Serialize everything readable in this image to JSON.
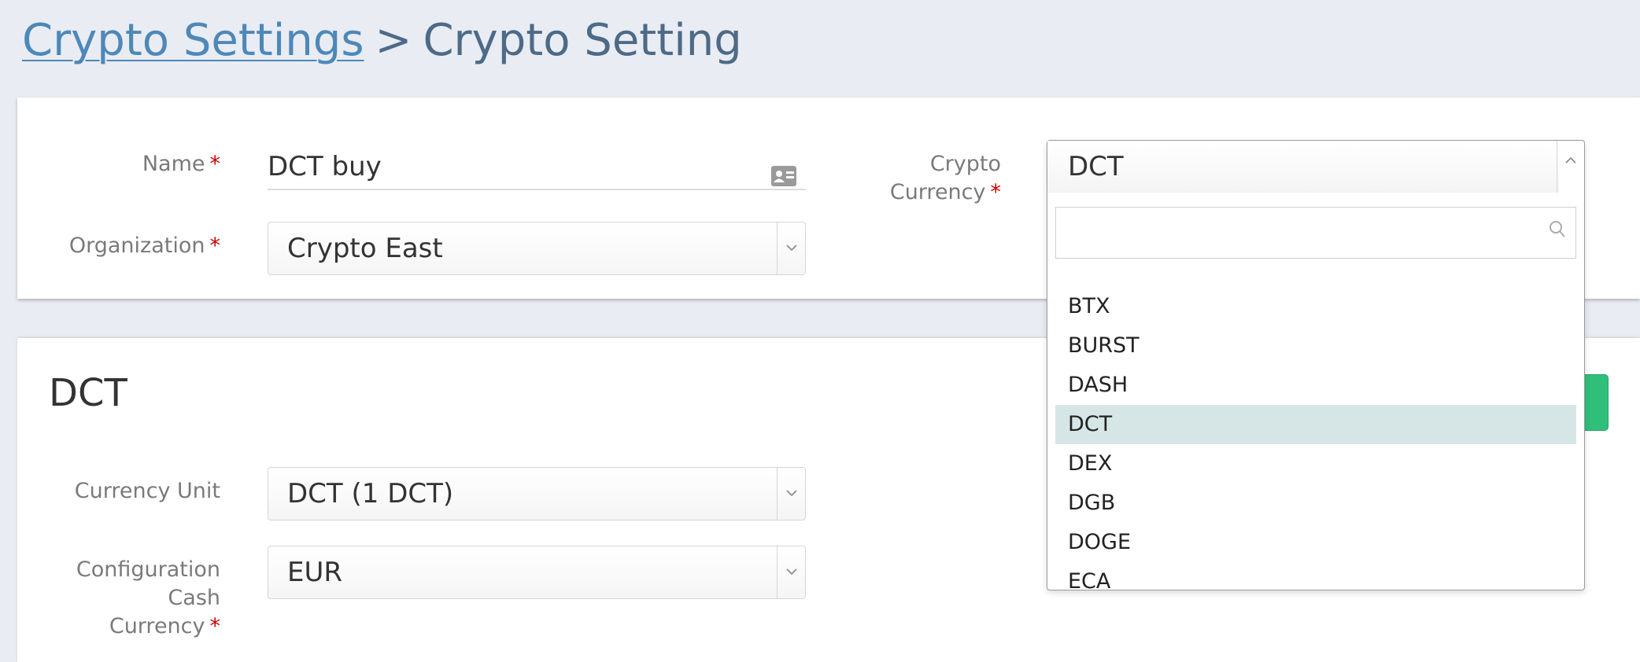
{
  "breadcrumb": {
    "parent": "Crypto Settings",
    "separator": ">",
    "current": "Crypto Setting"
  },
  "form": {
    "name_label": "Name",
    "name_value": "DCT buy",
    "organization_label": "Organization",
    "organization_value": "Crypto East",
    "crypto_currency_label_line1": "Crypto",
    "crypto_currency_label_line2": "Currency",
    "required_mark": "*"
  },
  "section": {
    "title": "DCT",
    "currency_unit_label": "Currency Unit",
    "currency_unit_value": "DCT (1 DCT)",
    "config_cash_label_line1": "Configuration",
    "config_cash_label_line2": "Cash",
    "config_cash_label_line3": "Currency",
    "config_cash_value": "EUR"
  },
  "dropdown": {
    "selected": "DCT",
    "search_placeholder": "",
    "options": [
      "BTX",
      "BURST",
      "DASH",
      "DCT",
      "DEX",
      "DGB",
      "DOGE",
      "ECA"
    ],
    "highlighted_index": 3
  },
  "colors": {
    "accent_green": "#2fbf7a",
    "link": "#4d88b8",
    "required": "#cc0000",
    "highlight": "#d6e6e6"
  }
}
